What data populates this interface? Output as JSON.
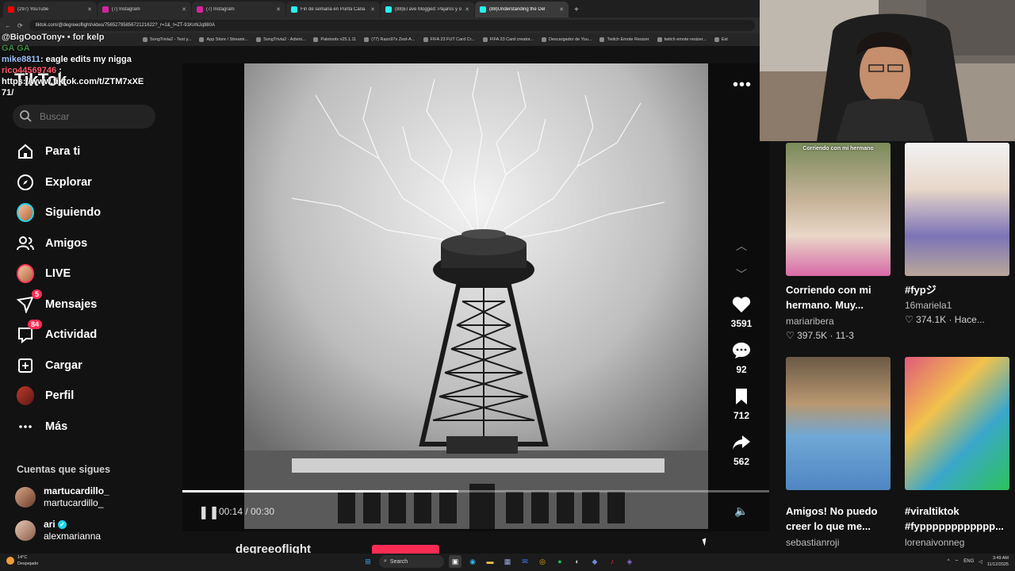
{
  "browser": {
    "tabs": [
      {
        "label": "(297) YouTube",
        "color": "#ff0000",
        "active": false
      },
      {
        "label": "(7) Instagram",
        "color": "#d6249f",
        "active": false
      },
      {
        "label": "(7) Instagram",
        "color": "#d6249f",
        "active": false
      },
      {
        "label": "Fin de semana en Punta Cana",
        "color": "#25f4ee",
        "active": false
      },
      {
        "label": "(88)El ave Mogged: Pájaros y o",
        "color": "#25f4ee",
        "active": false
      },
      {
        "label": "(88)Understanding the Del",
        "color": "#25f4ee",
        "active": true
      }
    ],
    "new_tab": "+",
    "url": "tiktok.com/@degreeoflight/video/7565279585672121622?_r=1&_t=ZT-91KnNJq980A",
    "bookmarks": [
      "SongTrivia2 - Test y...",
      "App Store / Streami...",
      "SongTrivia2 - Advini...",
      "Paletools v25.1.11",
      "(77) Razo97s Zest-A...",
      "FIFA 23 FUT Card Cr...",
      "FIFA 23 Card creator...",
      "Descargador de You...",
      "Twitch Emote Resizer",
      "twitch emote resizer...",
      "Est"
    ]
  },
  "chat": {
    "line1": "@BigOooTony• • for kelp",
    "ga": "GA  GA",
    "line2_user": "mike8811",
    "line2_text": ": eagle edits my nigga",
    "line3_user": "rico44569746",
    "line3_text": ":",
    "line4": "https://www.tiktok.com/t/ZTM7xXE",
    "line5": "71/"
  },
  "tiktok": {
    "logo": "TikTok",
    "search_placeholder": "Buscar",
    "nav": [
      {
        "label": "Para ti",
        "icon": "home-icon"
      },
      {
        "label": "Explorar",
        "icon": "compass-icon"
      },
      {
        "label": "Siguiendo",
        "icon": "following-avatar-icon"
      },
      {
        "label": "Amigos",
        "icon": "friends-icon"
      },
      {
        "label": "LIVE",
        "icon": "live-avatar-icon"
      },
      {
        "label": "Mensajes",
        "icon": "messages-icon",
        "badge": "5"
      },
      {
        "label": "Actividad",
        "icon": "activity-icon",
        "badge": "84"
      },
      {
        "label": "Cargar",
        "icon": "upload-icon"
      },
      {
        "label": "Perfil",
        "icon": "profile-avatar-icon"
      },
      {
        "label": "Más",
        "icon": "more-icon"
      }
    ],
    "following_title": "Cuentas que sigues",
    "following": [
      {
        "name": "martucardillo_",
        "handle": "martucardillo_"
      },
      {
        "name": "ari",
        "handle": "alexmarianna"
      }
    ]
  },
  "video": {
    "time": "00:14 / 00:30",
    "progress": 0.47,
    "author": "degreeoflight",
    "likes": "3591",
    "comments": "92",
    "saves": "712",
    "shares": "562"
  },
  "related": [
    {
      "caption_overlay": "Corriendo con mi hermano",
      "title": "Corriendo con mi hermano. Muy...",
      "author": "mariaribera",
      "stats": "397.5K · 11-3"
    },
    {
      "caption_overlay": "",
      "title": "#fypジ",
      "author": "16mariela1",
      "stats": "374.1K · Hace..."
    },
    {
      "caption_overlay": "",
      "title": "Amigos! No puedo creer lo que me...",
      "author": "sebastianroji",
      "stats": ""
    },
    {
      "caption_overlay": "",
      "title": "#viraltiktok #fypppppppppppp...",
      "author": "lorenaivonneg",
      "stats": ""
    }
  ],
  "taskbar": {
    "weather_temp": "14°C",
    "weather_desc": "Despejado",
    "search": "Search",
    "lang": "ENG",
    "time": "3:49 AM",
    "date": "11/12/2025"
  },
  "colors": {
    "accent": "#fe2c55",
    "bg": "#121212",
    "verified": "#20d5ec"
  }
}
